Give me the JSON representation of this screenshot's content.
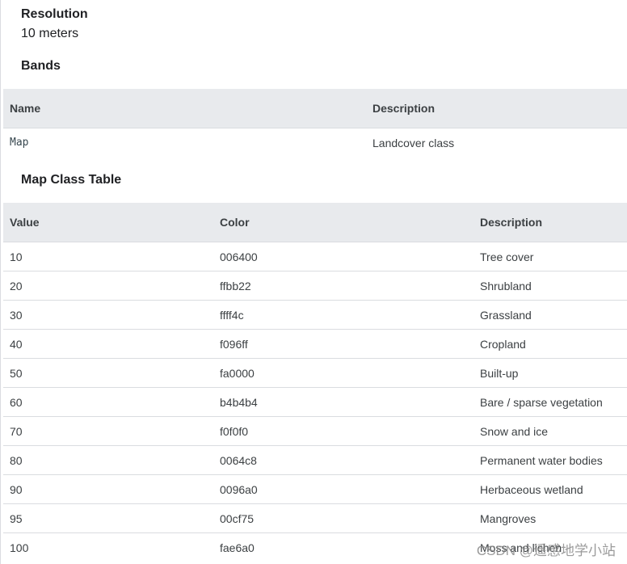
{
  "resolution": {
    "heading": "Resolution",
    "value": "10 meters"
  },
  "bands": {
    "heading": "Bands",
    "columns": [
      "Name",
      "Description"
    ],
    "rows": [
      {
        "name": "Map",
        "description": "Landcover class"
      }
    ]
  },
  "class_table": {
    "heading": "Map Class Table",
    "columns": [
      "Value",
      "Color",
      "Description"
    ],
    "rows": [
      {
        "value": "10",
        "color": "006400",
        "description": "Tree cover"
      },
      {
        "value": "20",
        "color": "ffbb22",
        "description": "Shrubland"
      },
      {
        "value": "30",
        "color": "ffff4c",
        "description": "Grassland"
      },
      {
        "value": "40",
        "color": "f096ff",
        "description": "Cropland"
      },
      {
        "value": "50",
        "color": "fa0000",
        "description": "Built-up"
      },
      {
        "value": "60",
        "color": "b4b4b4",
        "description": "Bare / sparse vegetation"
      },
      {
        "value": "70",
        "color": "f0f0f0",
        "description": "Snow and ice"
      },
      {
        "value": "80",
        "color": "0064c8",
        "description": "Permanent water bodies"
      },
      {
        "value": "90",
        "color": "0096a0",
        "description": "Herbaceous wetland"
      },
      {
        "value": "95",
        "color": "00cf75",
        "description": "Mangroves"
      },
      {
        "value": "100",
        "color": "fae6a0",
        "description": "Moss and lichen"
      }
    ]
  },
  "watermark": "CSDN @遥感地学小站"
}
